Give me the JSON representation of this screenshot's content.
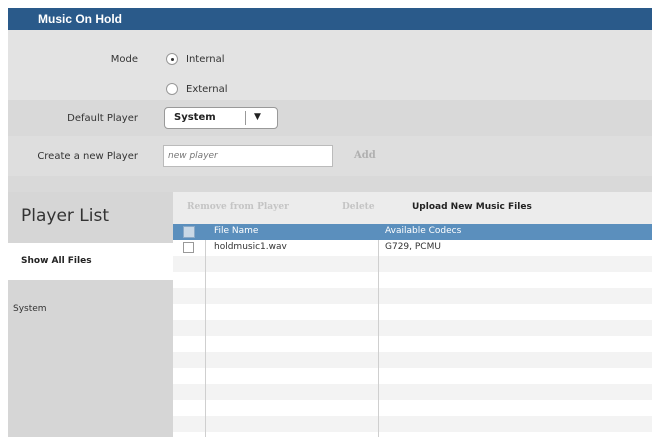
{
  "title": "Music On Hold",
  "mode": {
    "label": "Mode",
    "options": [
      {
        "label": "Internal",
        "selected": true
      },
      {
        "label": "External",
        "selected": false
      }
    ]
  },
  "default_player": {
    "label": "Default Player",
    "value": "System"
  },
  "new_player": {
    "label": "Create a new Player",
    "placeholder": "new player",
    "add_label": "Add"
  },
  "sidebar": {
    "title": "Player List",
    "items": [
      {
        "label": "Show All Files",
        "active": true
      },
      {
        "label": "System",
        "active": false
      }
    ]
  },
  "toolbar": {
    "remove_label": "Remove from Player",
    "delete_label": "Delete",
    "upload_label": "Upload New Music Files"
  },
  "table": {
    "columns": [
      "File Name",
      "Available Codecs"
    ],
    "rows": [
      {
        "file": "holdmusic1.wav",
        "codecs": "G729, PCMU"
      }
    ]
  }
}
